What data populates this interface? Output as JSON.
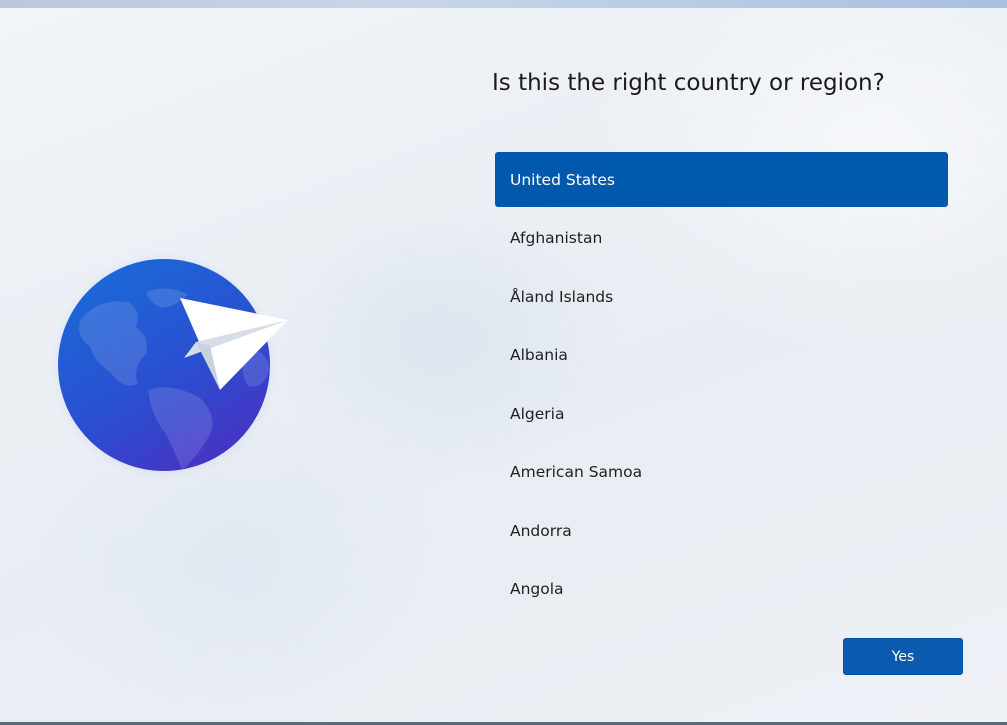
{
  "header": {
    "title": "Is this the right country or region?"
  },
  "country_list": {
    "items": [
      {
        "label": "United States",
        "selected": true
      },
      {
        "label": "Afghanistan",
        "selected": false
      },
      {
        "label": "Åland Islands",
        "selected": false
      },
      {
        "label": "Albania",
        "selected": false
      },
      {
        "label": "Algeria",
        "selected": false
      },
      {
        "label": "American Samoa",
        "selected": false
      },
      {
        "label": "Andorra",
        "selected": false
      },
      {
        "label": "Angola",
        "selected": false
      }
    ]
  },
  "footer": {
    "yes_label": "Yes"
  },
  "illustration": {
    "icon": "globe-paper-plane-icon"
  },
  "colors": {
    "accent": "#0159ae",
    "button": "#0a5ab0",
    "globe_top": "#1766d6",
    "globe_bottom": "#4b2fc4",
    "background": "#eef2f7"
  }
}
